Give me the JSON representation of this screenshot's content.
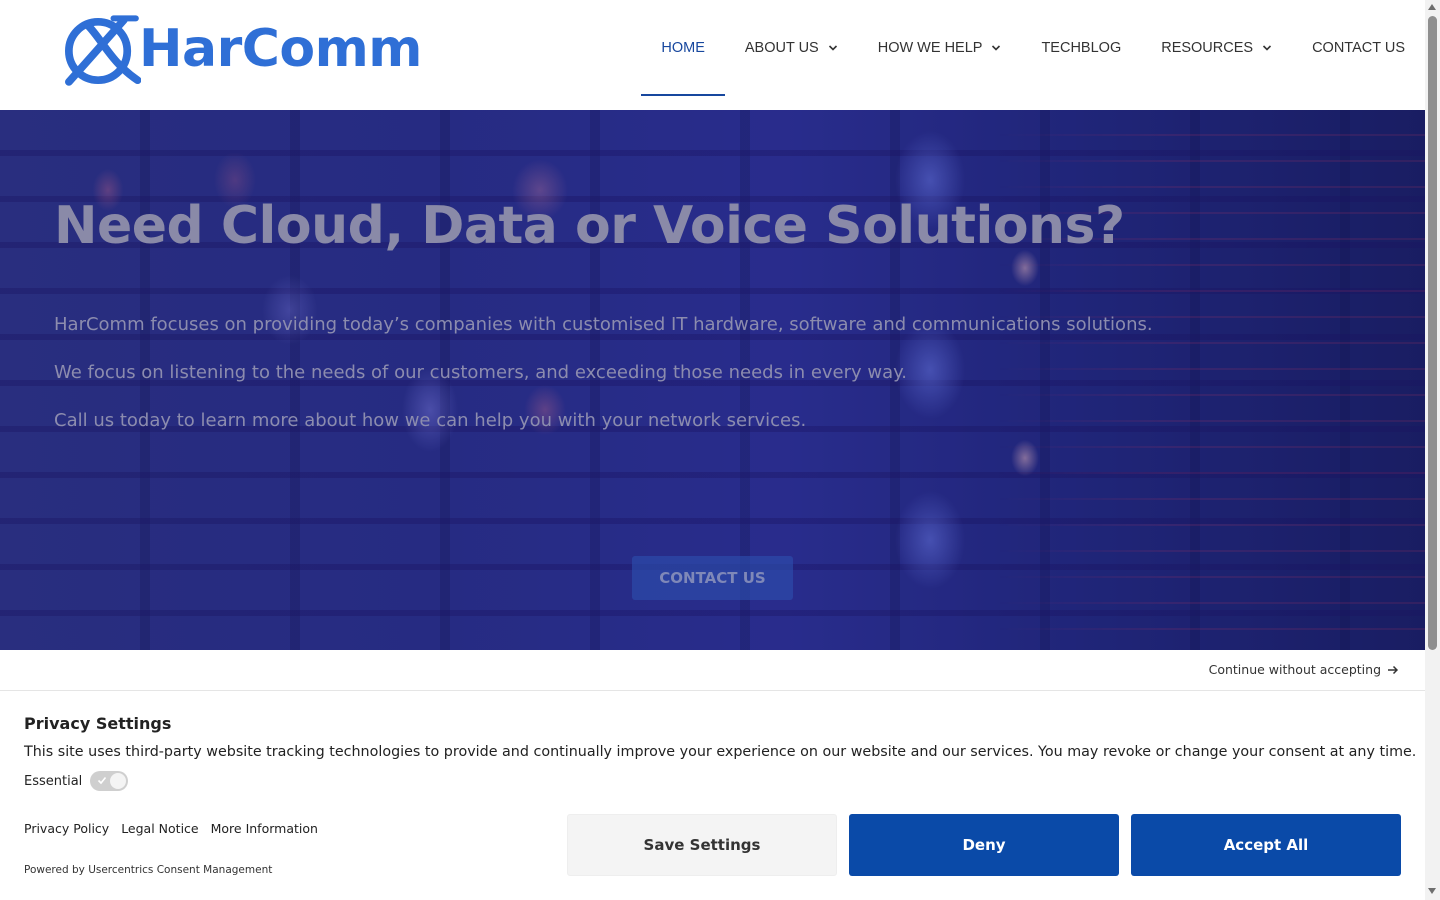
{
  "brand": {
    "name": "HarComm",
    "color": "#2f6fd6"
  },
  "nav": {
    "items": [
      {
        "label": "HOME",
        "active": true,
        "dropdown": false
      },
      {
        "label": "ABOUT US",
        "active": false,
        "dropdown": true
      },
      {
        "label": "HOW WE HELP",
        "active": false,
        "dropdown": true
      },
      {
        "label": "TECHBLOG",
        "active": false,
        "dropdown": false
      },
      {
        "label": "RESOURCES",
        "active": false,
        "dropdown": true
      },
      {
        "label": "CONTACT US",
        "active": false,
        "dropdown": false
      }
    ],
    "active_color": "#17479e"
  },
  "hero": {
    "title": "Need Cloud, Data or Voice Solutions?",
    "paragraphs": [
      "HarComm focuses on providing today’s companies with customised IT hardware, software and communications solutions.",
      "We focus on listening to the needs of our customers, and exceeding those needs in every way.",
      "Call us today to learn more about how we can help you with your network services."
    ],
    "cta_label": "CONTACT US"
  },
  "consent": {
    "continue_label": "Continue without accepting",
    "title": "Privacy Settings",
    "text": "This site uses third-party website tracking technologies to provide and continually improve your experience on our website and our services. You may revoke or change your consent at any time.",
    "essential_label": "Essential",
    "essential_enabled": true,
    "links": [
      "Privacy Policy",
      "Legal Notice",
      "More Information"
    ],
    "powered_by": "Powered by Usercentrics Consent Management",
    "buttons": {
      "save": "Save Settings",
      "deny": "Deny",
      "accept": "Accept All"
    },
    "primary_color": "#0a4aa8"
  }
}
